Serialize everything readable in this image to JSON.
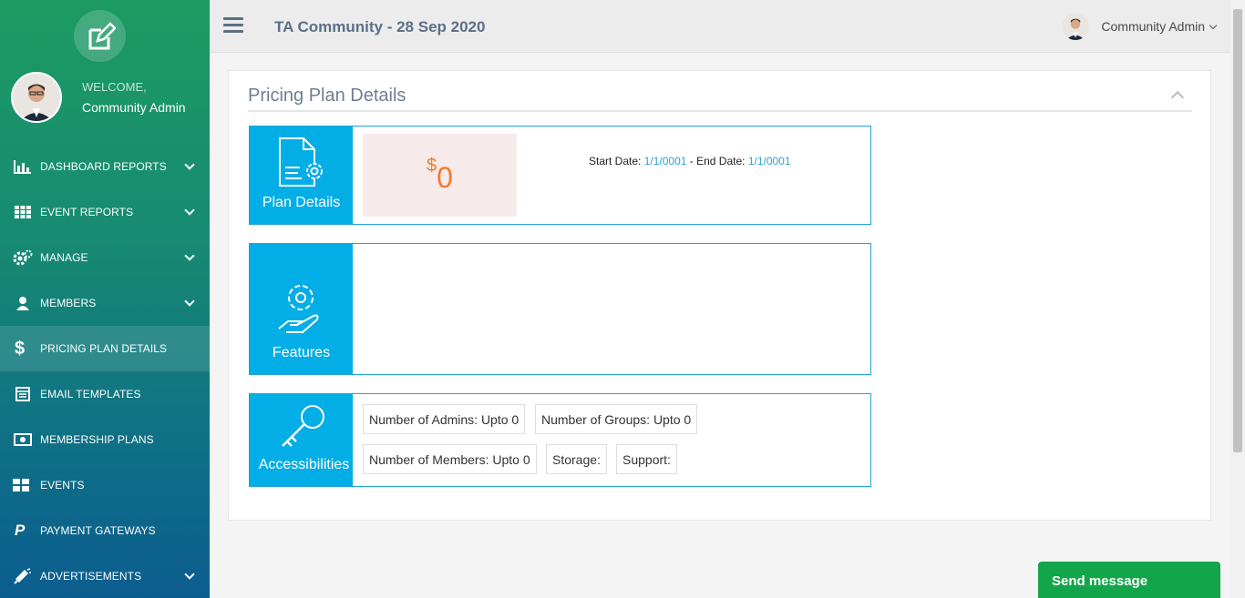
{
  "sidebar": {
    "welcome": "WELCOME,",
    "user": "Community Admin",
    "items": [
      {
        "label": "DASHBOARD REPORTS",
        "icon": "bar-chart-icon",
        "chevron": true
      },
      {
        "label": "EVENT REPORTS",
        "icon": "grid-icon",
        "chevron": true
      },
      {
        "label": "MANAGE",
        "icon": "gears-icon",
        "chevron": true
      },
      {
        "label": "MEMBERS",
        "icon": "user-icon",
        "chevron": true
      },
      {
        "label": "PRICING PLAN DETAILS",
        "icon": "dollar-icon",
        "chevron": false,
        "active": true
      },
      {
        "label": "EMAIL TEMPLATES",
        "icon": "template-icon",
        "chevron": false
      },
      {
        "label": "MEMBERSHIP PLANS",
        "icon": "money-icon",
        "chevron": false
      },
      {
        "label": "EVENTS",
        "icon": "tiles-icon",
        "chevron": false
      },
      {
        "label": "PAYMENT GATEWAYS",
        "icon": "paypal-icon",
        "chevron": false
      },
      {
        "label": "ADVERTISEMENTS",
        "icon": "megaphone-icon",
        "chevron": true
      }
    ]
  },
  "header": {
    "title": "TA Community - 28 Sep 2020",
    "user": "Community Admin"
  },
  "panel": {
    "title": "Pricing Plan Details",
    "plan": {
      "side_label": "Plan Details",
      "currency": "$",
      "amount": "0",
      "start_label": "Start Date:",
      "start_value": "1/1/0001",
      "sep": " - ",
      "end_label": "End Date:",
      "end_value": "1/1/0001"
    },
    "features": {
      "side_label": "Features"
    },
    "accessibilities": {
      "side_label": "Accessibilities",
      "chips": [
        "Number of Admins: Upto 0",
        "Number of Groups: Upto 0",
        "Number of Members: Upto 0",
        "Storage:",
        "Support:"
      ]
    }
  },
  "send_message": "Send message",
  "colors": {
    "accent": "#03aee6",
    "price": "#f47a2a",
    "send_button": "#13a54a"
  }
}
